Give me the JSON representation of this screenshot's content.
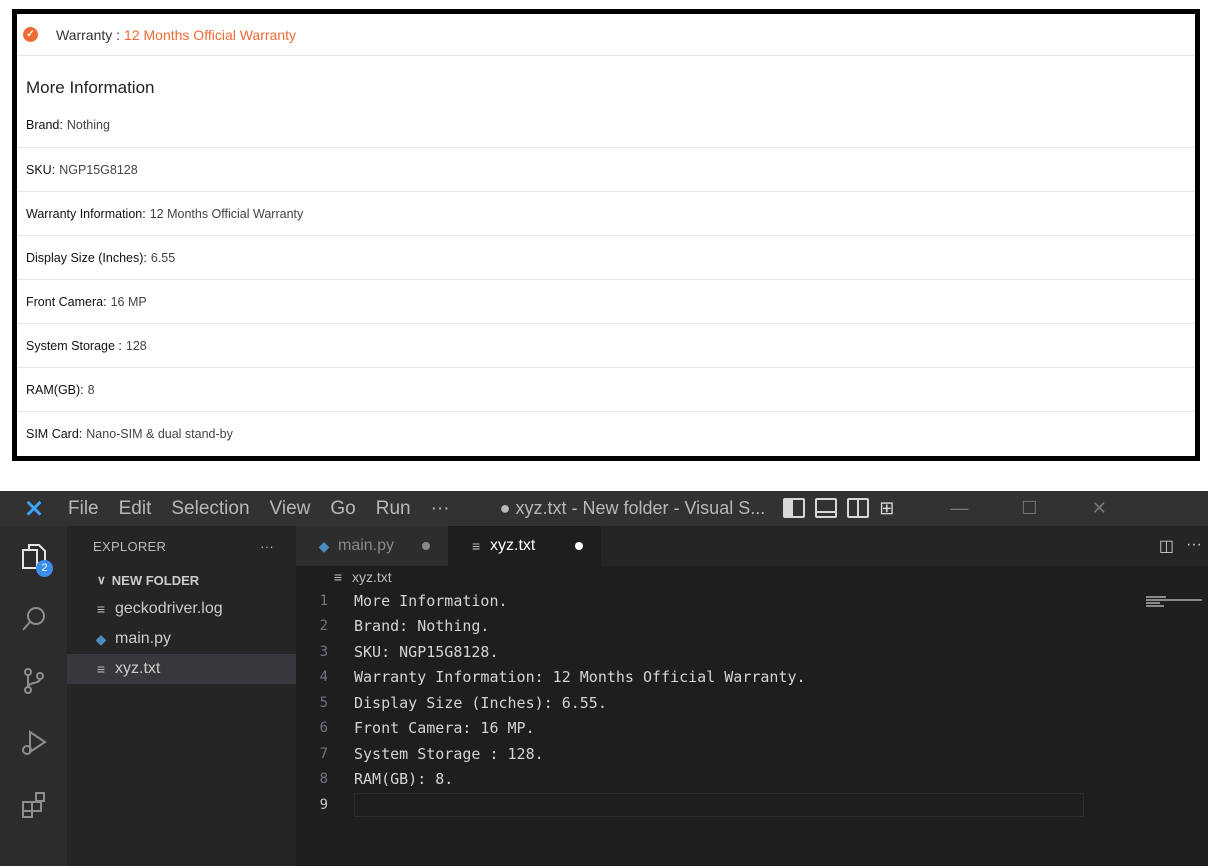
{
  "product": {
    "warranty_label": "Warranty :",
    "warranty_value": "12 Months Official Warranty",
    "more_info_title": "More Information",
    "rows": [
      {
        "key": "Brand:",
        "value": "Nothing"
      },
      {
        "key": "SKU:",
        "value": "NGP15G8128"
      },
      {
        "key": "Warranty Information:",
        "value": "12 Months Official Warranty"
      },
      {
        "key": "Display Size (Inches):",
        "value": "6.55"
      },
      {
        "key": "Front Camera:",
        "value": "16 MP"
      },
      {
        "key": "System Storage :",
        "value": "128"
      },
      {
        "key": "RAM(GB):",
        "value": "8"
      },
      {
        "key": "SIM Card:",
        "value": "Nano-SIM & dual stand-by"
      }
    ]
  },
  "vscode": {
    "menu": [
      "File",
      "Edit",
      "Selection",
      "View",
      "Go",
      "Run",
      "···"
    ],
    "window_title": "● xyz.txt - New folder - Visual S...",
    "activity_badge": "2",
    "explorer_title": "EXPLORER",
    "explorer_more": "···",
    "folder_name": "NEW FOLDER",
    "files": [
      "geckodriver.log",
      "main.py",
      "xyz.txt"
    ],
    "tabs": [
      "main.py",
      "xyz.txt"
    ],
    "breadcrumb": "xyz.txt",
    "code_lines": [
      {
        "n": "1",
        "text": "More Information."
      },
      {
        "n": "2",
        "text": "Brand: Nothing."
      },
      {
        "n": "3",
        "text": "SKU: NGP15G8128."
      },
      {
        "n": "4",
        "text": "Warranty Information: 12 Months Official Warranty."
      },
      {
        "n": "5",
        "text": "Display Size (Inches): 6.55."
      },
      {
        "n": "6",
        "text": "Front Camera: 16 MP."
      },
      {
        "n": "7",
        "text": "System Storage : 128."
      },
      {
        "n": "8",
        "text": "RAM(GB): 8."
      },
      {
        "n": "9",
        "text": ""
      }
    ],
    "icons": {
      "explorer": "files-icon",
      "search": "search-icon",
      "scm": "source-control-icon",
      "debug": "run-debug-icon",
      "extensions": "extensions-icon"
    }
  }
}
